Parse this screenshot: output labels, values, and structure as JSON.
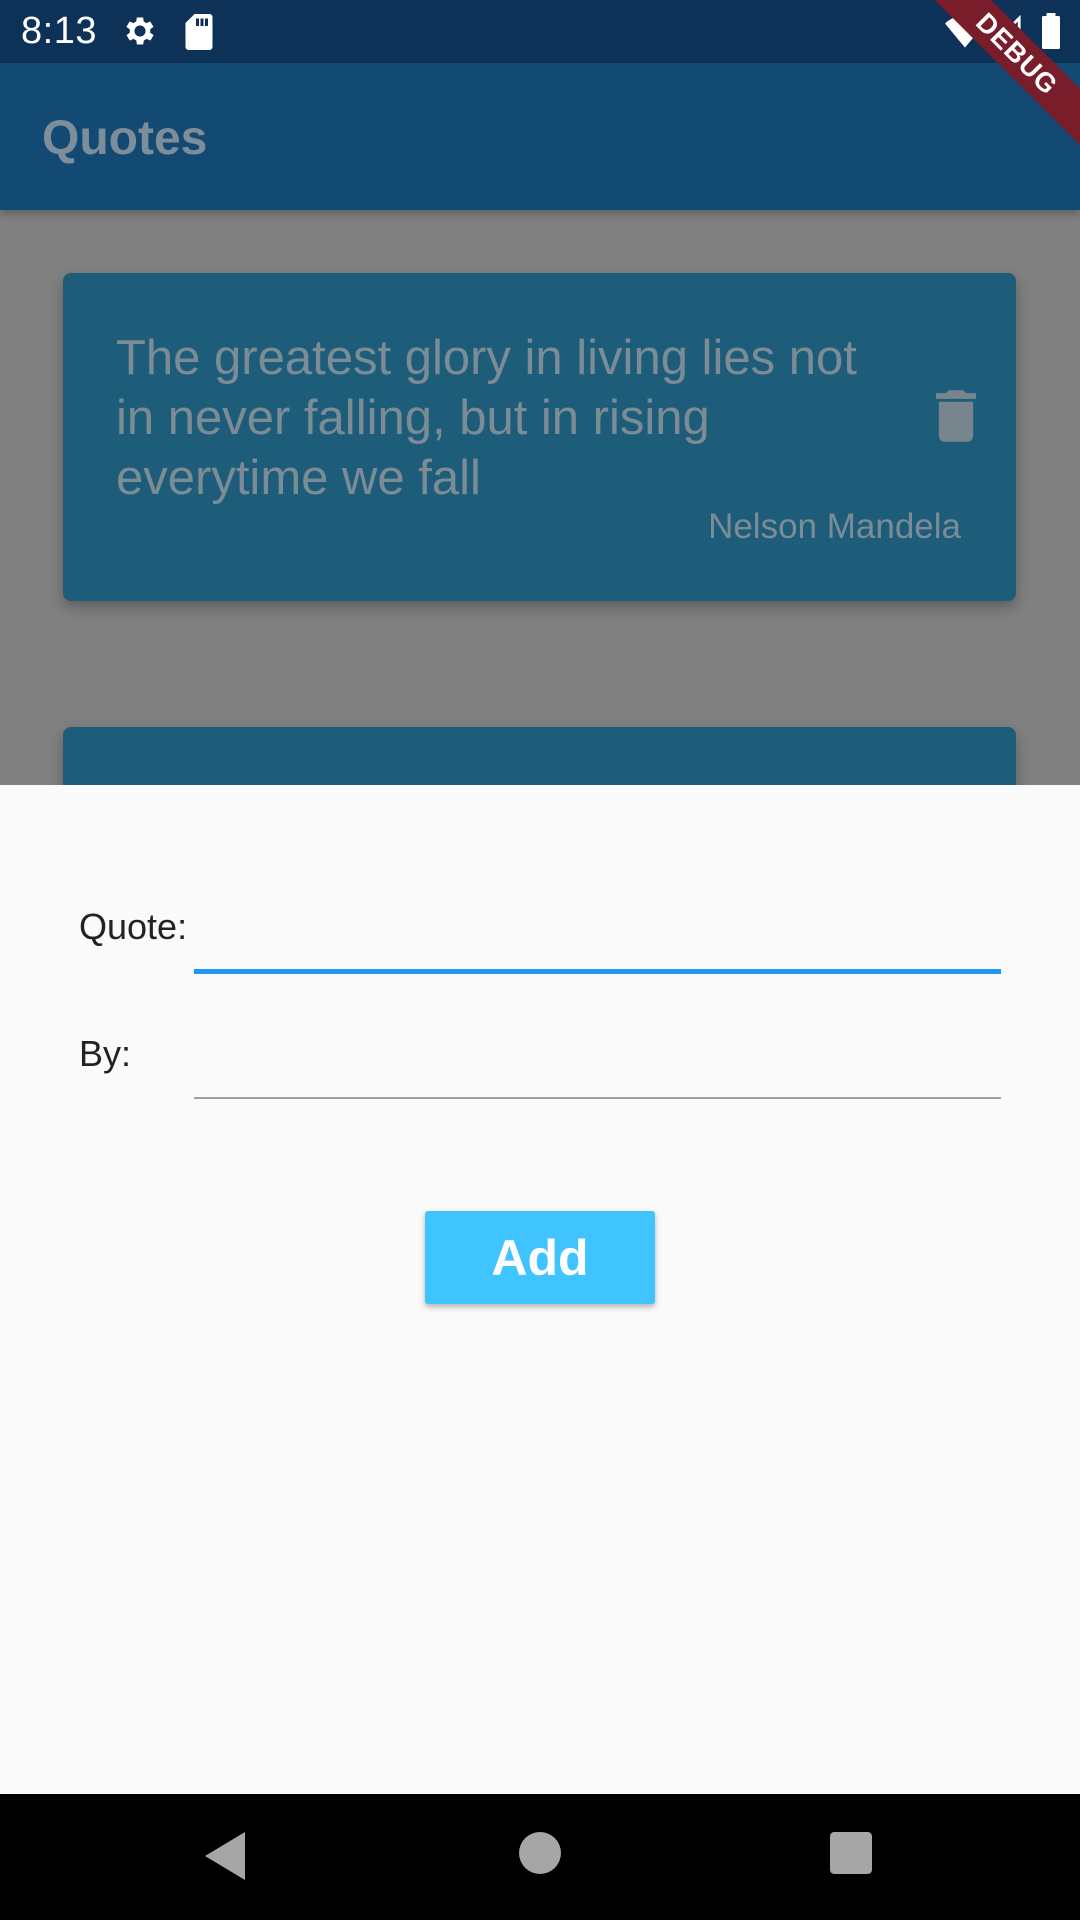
{
  "status_bar": {
    "time": "8:13",
    "icons": [
      "gear-icon",
      "sd-card-icon",
      "wifi-icon",
      "signal-icon",
      "battery-icon"
    ]
  },
  "app_bar": {
    "title": "Quotes"
  },
  "debug_banner": {
    "label": "DEBUG"
  },
  "quotes": [
    {
      "text": "The greatest glory in living lies not in never falling, but in rising everytime we fall",
      "author": "Nelson Mandela",
      "icon": "trash-icon"
    }
  ],
  "form": {
    "quote_label": "Quote:",
    "quote_value": "",
    "by_label": "By:",
    "by_value": "",
    "add_button_label": "Add"
  },
  "nav_bar": {
    "icons": [
      "back-icon",
      "home-icon",
      "recents-icon"
    ]
  },
  "colors": {
    "status_bar": "#0d3157",
    "app_bar": "#134a74",
    "card": "#1e5d7a",
    "scrim": "#808080",
    "accent": "#40c4ff",
    "input_focus": "#2196f3",
    "debug_banner": "#7a1d2b"
  }
}
